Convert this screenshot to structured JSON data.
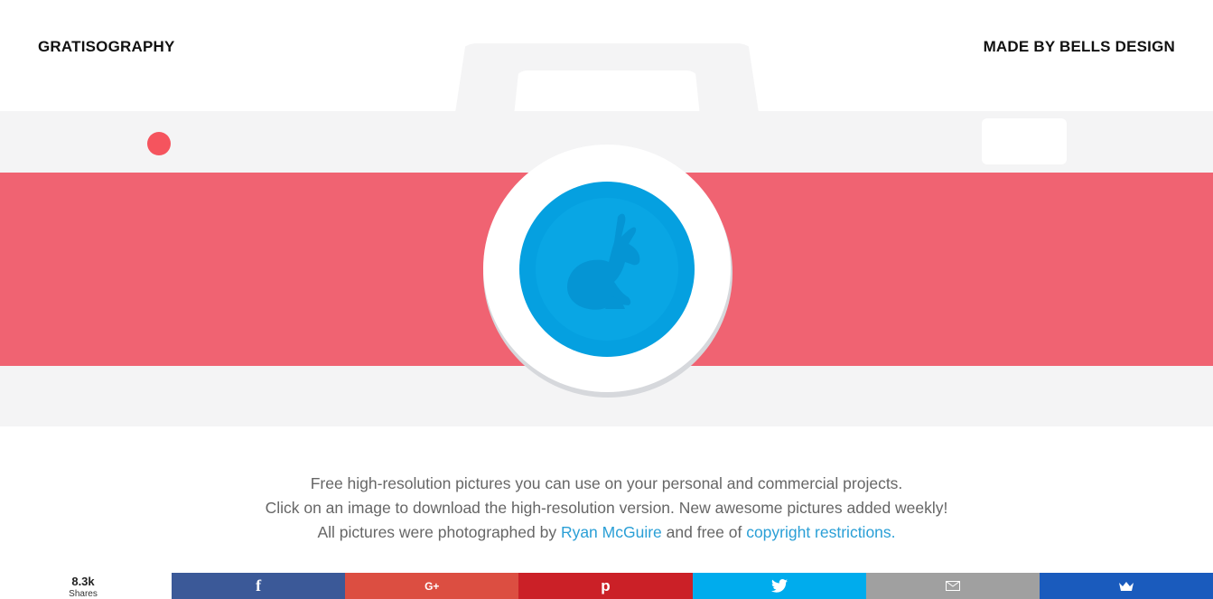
{
  "header": {
    "logo_text": "GRATISOGRAPHY",
    "credit_text": "MADE BY BELLS DESIGN"
  },
  "hero": {
    "stripe_color": "#f06372",
    "lens_color": "#05a0e0",
    "camera_body_color": "#f4f4f5",
    "icon": "rabbit-icon"
  },
  "intro": {
    "line1": "Free high-resolution pictures you can use on your personal and commercial projects.",
    "line2": "Click on an image to download the high-resolution version. New awesome pictures added weekly!",
    "line3_prefix": "All pictures were photographed by ",
    "author_link": "Ryan McGuire",
    "line3_middle": " and free of ",
    "copyright_link": "copyright restrictions.",
    "link_color": "#2a9fd6"
  },
  "share": {
    "count": "8.3k",
    "count_label": "Shares",
    "buttons": [
      {
        "network": "facebook",
        "icon": "facebook-icon",
        "glyph": "f",
        "color": "#3b5998"
      },
      {
        "network": "google-plus",
        "icon": "google-plus-icon",
        "glyph": "G+",
        "color": "#dc4e41"
      },
      {
        "network": "pinterest",
        "icon": "pinterest-icon",
        "glyph": "p",
        "color": "#cb2027"
      },
      {
        "network": "twitter",
        "icon": "twitter-icon",
        "icon_name": "bird",
        "color": "#00aced"
      },
      {
        "network": "email",
        "icon": "email-icon",
        "icon_name": "envelope",
        "color": "#a0a0a0"
      },
      {
        "network": "sumome",
        "icon": "crown-icon",
        "icon_name": "crown",
        "color": "#1a5bbd"
      }
    ]
  }
}
